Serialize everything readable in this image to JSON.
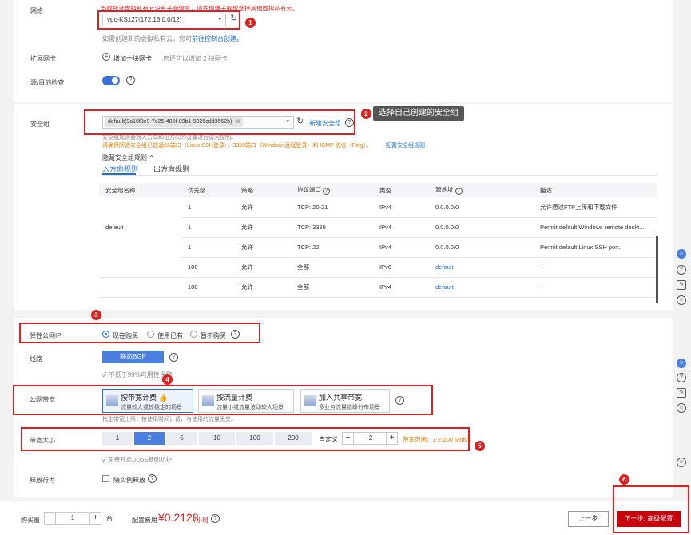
{
  "network": {
    "label": "网络",
    "notice": "当前所选虚拟私有云没有子网信息，请先创建子网或选择其他虚拟私有云。",
    "vpc_value": "vpc-KS127(172.16.0.0/12)",
    "hint_prefix": "如需创建新的虚拟私有云，您可",
    "hint_link": "前往控制台创建。"
  },
  "nic": {
    "label": "扩展网卡",
    "add_label": "增加一块网卡",
    "remaining": "您还可以增加 2 块网卡"
  },
  "src_dst_check": {
    "label": "源/目的检查"
  },
  "security_group": {
    "label": "安全组",
    "value": "default(9a16f3e9-7e25-485f-89b1-9026cdd3562b)",
    "new_link": "新建安全组",
    "notice_blue": "安全组规则会对入方向和出方向的流量进行访问控制。",
    "notice_orange": "请确保所选安全组已放通22端口（Linux SSH登录），3389端口（Windows远程登录）和 ICMP 协议（Ping）。",
    "config_link": "配置安全组规则",
    "toggle_label": "隐藏安全组规则",
    "tabs": [
      "入方向规则",
      "出方向规则"
    ],
    "columns": [
      "安全组名称",
      "优先级",
      "策略",
      "协议端口",
      "类型",
      "源地址",
      "描述"
    ],
    "group_name": "default",
    "rows": [
      {
        "priority": "1",
        "policy": "允许",
        "port": "TCP: 20-21",
        "type": "IPv4",
        "source": "0.0.0.0/0",
        "desc": "允许通过FTP上传和下载文件"
      },
      {
        "priority": "1",
        "policy": "允许",
        "port": "TCP: 3389",
        "type": "IPv4",
        "source": "0.0.0.0/0",
        "desc": "Permit default Windows remote deskt..."
      },
      {
        "priority": "1",
        "policy": "允许",
        "port": "TCP: 22",
        "type": "IPv4",
        "source": "0.0.0.0/0",
        "desc": "Permit default Linux SSH port."
      },
      {
        "priority": "100",
        "policy": "允许",
        "port": "全部",
        "type": "IPv6",
        "source": "default",
        "desc": "--"
      },
      {
        "priority": "100",
        "policy": "允许",
        "port": "全部",
        "type": "IPv4",
        "source": "default",
        "desc": "--"
      }
    ]
  },
  "eip": {
    "label": "弹性公网IP",
    "options": [
      "现在购买",
      "使用已有",
      "暂不购买"
    ],
    "selected": 0
  },
  "line": {
    "label": "线路",
    "value": "静态BGP",
    "sla": "不低于99%可用性保障"
  },
  "bandwidth": {
    "label": "公网带宽",
    "cards": [
      {
        "title": "按带宽计费",
        "desc": "流量较大或较稳定的场景"
      },
      {
        "title": "按流量计费",
        "desc": "流量小或流量波动较大场景"
      },
      {
        "title": "加入共享带宽",
        "desc": "多业务流量错峰分布场景"
      }
    ],
    "selected": 0,
    "note": "指定带宽上限，按使用时间计费，与使用的流量无关。"
  },
  "bw_size": {
    "label": "带宽大小",
    "options": [
      "1",
      "2",
      "5",
      "10",
      "100",
      "200"
    ],
    "selected": 1,
    "custom_label": "自定义",
    "custom_value": "2",
    "range": "带宽范围：1-2,000 Mbit/s",
    "ddos": "免费开启DDoS基础防护"
  },
  "release": {
    "label": "释放行为",
    "checkbox": "随实例释放"
  },
  "footer": {
    "qty_label": "购买量",
    "qty_value": "1",
    "qty_unit": "台",
    "fee_label": "配置费用",
    "fee_value": "¥0.2128",
    "fee_unit": "/小时",
    "prev": "上一步",
    "next": "下一步: 高级配置"
  },
  "annotations": {
    "n1": "1",
    "n2": "2",
    "n3": "3",
    "n4": "4",
    "n5": "5",
    "n6": "6",
    "tip2": "选择自己创建的安全组"
  },
  "colors": {
    "accent": "#1f6fd6",
    "highlight": "#e02020",
    "primary_button": "#c7000b"
  }
}
